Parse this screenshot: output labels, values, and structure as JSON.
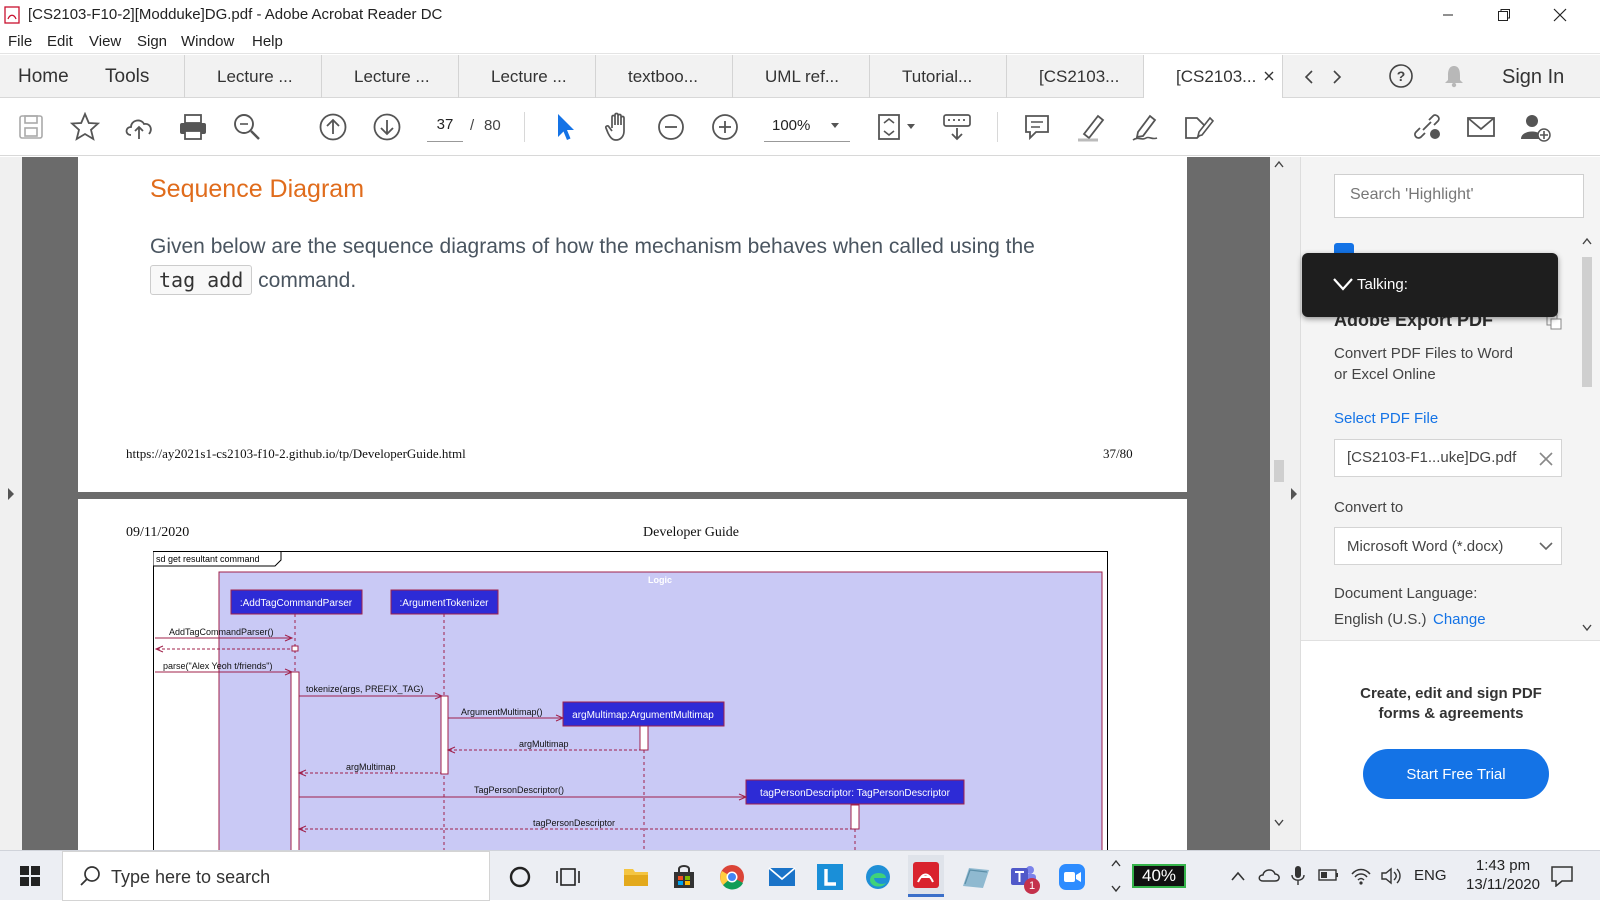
{
  "window": {
    "title": "[CS2103-F10-2][Modduke]DG.pdf - Adobe Acrobat Reader DC",
    "minimize_icon": "minimize-icon",
    "maximize_icon": "maximize-icon",
    "close_icon": "close-icon"
  },
  "menu": [
    "File",
    "Edit",
    "View",
    "Sign",
    "Window",
    "Help"
  ],
  "nav": {
    "home": "Home",
    "tools": "Tools",
    "tabs": [
      "Lecture ...",
      "Lecture ...",
      "Lecture ...",
      "textboo...",
      "UML ref...",
      "Tutorial...",
      "[CS2103...",
      "[CS2103..."
    ],
    "active_tab_index": 7,
    "sign_in": "Sign In"
  },
  "toolbar": {
    "page_current": "37",
    "page_separator": "/",
    "page_total": "80",
    "zoom": "100%"
  },
  "document": {
    "heading": "Sequence Diagram",
    "para_prefix": "Given below are the sequence diagrams of how the mechanism behaves when called using the",
    "code": "tag add",
    "para_suffix": "command.",
    "footer_url": "https://ay2021s1-cs2103-f10-2.github.io/tp/DeveloperGuide.html",
    "footer_page": "37/80",
    "next_date": "09/11/2020",
    "next_title": "Developer Guide",
    "diagram": {
      "frame_label": "sd get resultant command",
      "box_label": "Logic",
      "objects": [
        ":AddTagCommandParser",
        ":ArgumentTokenizer",
        "argMultimap:ArgumentMultimap",
        "tagPersonDescriptor: TagPersonDescriptor"
      ],
      "messages": [
        "AddTagCommandParser()",
        "parse(\"Alex Yeoh t/friends\")",
        "tokenize(args, PREFIX_TAG)",
        "ArgumentMultimap()",
        "argMultimap",
        "argMultimap",
        "TagPersonDescriptor()",
        "tagPersonDescriptor"
      ]
    }
  },
  "rightpane": {
    "search_placeholder": "Search 'Highlight'",
    "talking": "Talking:",
    "export_title": "Adobe Export PDF",
    "export_desc1": "Convert PDF Files to Word",
    "export_desc2": "or Excel Online",
    "select_pdf": "Select PDF File",
    "selected_file": "[CS2103-F1...uke]DG.pdf",
    "convert_to": "Convert to",
    "convert_value": "Microsoft Word (*.docx)",
    "doc_language": "Document Language:",
    "language_value": "English (U.S.)",
    "change": "Change",
    "promo1": "Create, edit and sign PDF",
    "promo2": "forms & agreements",
    "trial_button": "Start Free Trial"
  },
  "taskbar": {
    "search_placeholder": "Type here to search",
    "battery": "40%",
    "lang": "ENG",
    "time": "1:43 pm",
    "date": "13/11/2020",
    "teams_badge": "1"
  }
}
